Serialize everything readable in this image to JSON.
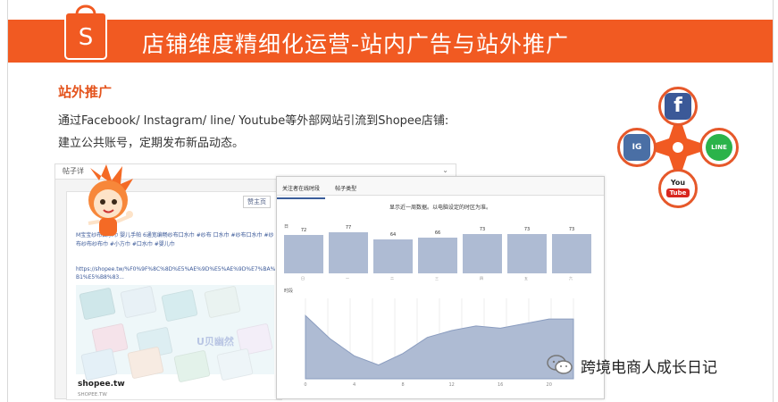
{
  "slide": {
    "title": "店铺维度精细化运营-站内广告与站外推广",
    "section_title": "站外推广",
    "line1": "通过Facebook/ Instagram/ line/ Youtube等外部网站引流到Shopee店铺:",
    "line2": "建立公共账号，定期发布新品动态。",
    "brand_letter": "S"
  },
  "screenshot_left": {
    "bar_text": "帖子详",
    "like_label": "赞主页",
    "post_text": "M宝宝纱布口水巾 婴儿手帕 6通宽编畅纱布口水巾 #纱布 口水巾 #纱布口水巾 #纱布纱布纱布巾 #小方巾 #口水巾 #婴儿巾",
    "post_url": "https://shopee.tw/%F0%9F%8C%8D%E5%AE%9D%E5%AE%9D%E7%BA%B1%E5%B8%83...",
    "watermark": "U贝幽然",
    "shop_name": "shopee.tw",
    "shop_sub": "SHOPEE.TW"
  },
  "screenshot_right": {
    "tabs": [
      "关注者在线时段",
      "帖子类型"
    ],
    "notice": "显示近一周数据。以电脑设定的时区为准。",
    "section1_label": "日",
    "section2_label": "时段"
  },
  "chart_data": [
    {
      "type": "bar",
      "categories": [
        "日",
        "一",
        "二",
        "三",
        "四",
        "五",
        "六"
      ],
      "values": [
        72,
        77,
        64,
        66,
        73,
        73,
        73
      ],
      "ylim": [
        0,
        100
      ]
    },
    {
      "type": "area",
      "x": [
        "0",
        "2",
        "4",
        "6",
        "8",
        "10",
        "12",
        "14",
        "16",
        "18",
        "20",
        "22"
      ],
      "values": [
        55,
        35,
        20,
        12,
        22,
        36,
        42,
        46,
        44,
        48,
        52,
        52
      ],
      "ylim": [
        0,
        70
      ]
    }
  ],
  "social": {
    "facebook": "f",
    "instagram": "IG",
    "line": "LINE",
    "youtube_top": "You",
    "youtube_bottom": "Tube",
    "colors": {
      "facebook": "#3b5998",
      "instagram": "#4a6fa5",
      "line": "#2bb34a",
      "youtube": "#d8261f",
      "accent": "#f15a22"
    }
  },
  "footer": {
    "brand": "跨境电商人成长日记"
  }
}
